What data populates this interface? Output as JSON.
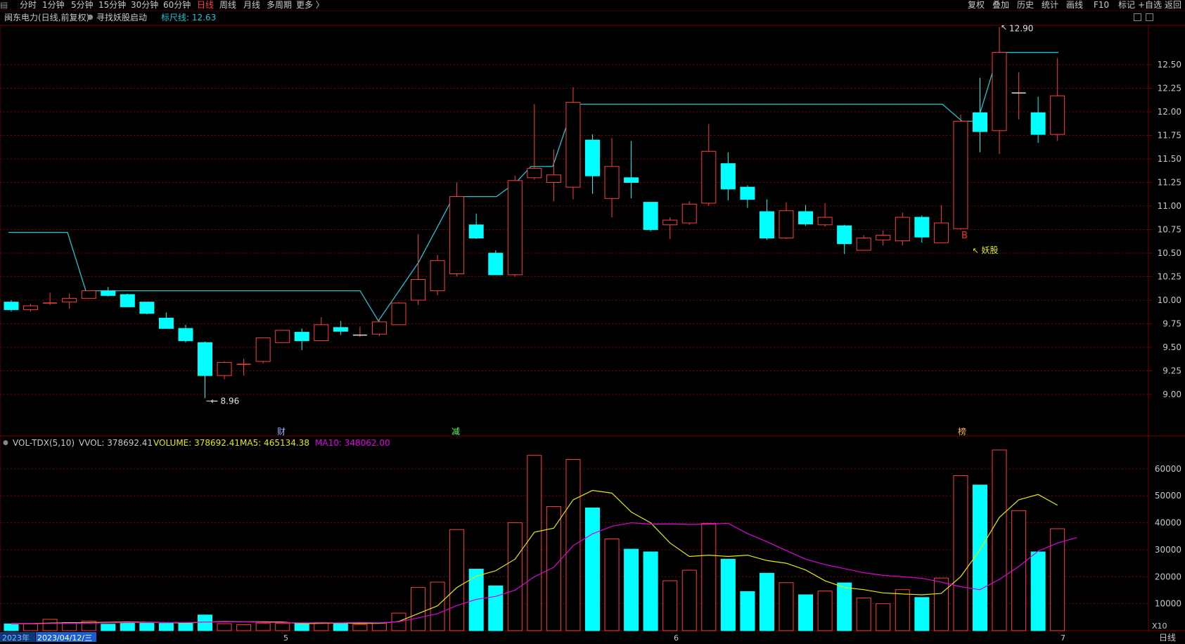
{
  "toolbar": {
    "left_items": [
      "分时",
      "1分钟",
      "5分钟",
      "15分钟",
      "30分钟",
      "60分钟",
      "日线",
      "周线",
      "月线",
      "多周期",
      "更多 〉"
    ],
    "active": "日线",
    "right_items": [
      "复权",
      "叠加",
      "历史",
      "统计",
      "画线",
      "F10",
      "标记",
      "+自选",
      "返回"
    ]
  },
  "info": {
    "stock": "闽东电力(日线,前复权)",
    "indicator": "寻找妖股启动",
    "ruler": "标尺线: 12.63"
  },
  "vol_info": {
    "name": "VOL-TDX(5,10)",
    "vvol": "VVOL: 378692.41",
    "volume": "VOLUME: 378692.41",
    "ma5": "MA5: 465134.38",
    "ma10": "MA10: 348062.00"
  },
  "colors": {
    "up": "#ff3d3d",
    "down": "#00ffff",
    "grid": "#7a0000",
    "guide": "#19c7d4",
    "ma5": "#e8e800",
    "ma10": "#e000e0",
    "axis_text": "#c8c8c8",
    "label": "#ff8c00"
  },
  "chart_data": {
    "type": "candlestick",
    "price_axis": {
      "ylim": [
        8.8,
        13.0
      ],
      "ticks": [
        "9.00",
        "9.25",
        "9.50",
        "9.75",
        "10.00",
        "10.25",
        "10.50",
        "10.75",
        "11.00",
        "11.25",
        "11.50",
        "11.75",
        "12.00",
        "12.25",
        "12.50"
      ]
    },
    "volume_axis": {
      "ylim": [
        0,
        67000
      ],
      "ticks": [
        "10000",
        "20000",
        "30000",
        "40000",
        "50000",
        "60000"
      ],
      "unit_label": "X10"
    },
    "candles": [
      {
        "o": 9.98,
        "h": 10.0,
        "l": 9.88,
        "c": 9.9
      },
      {
        "o": 9.9,
        "h": 9.96,
        "l": 9.88,
        "c": 9.94
      },
      {
        "o": 9.97,
        "h": 10.08,
        "l": 9.95,
        "c": 9.97
      },
      {
        "o": 9.98,
        "h": 10.07,
        "l": 9.91,
        "c": 10.02
      },
      {
        "o": 10.02,
        "h": 10.1,
        "l": 10.02,
        "c": 10.1
      },
      {
        "o": 10.1,
        "h": 10.14,
        "l": 10.04,
        "c": 10.05
      },
      {
        "o": 10.06,
        "h": 10.07,
        "l": 9.93,
        "c": 9.93
      },
      {
        "o": 9.98,
        "h": 9.98,
        "l": 9.85,
        "c": 9.86
      },
      {
        "o": 9.81,
        "h": 9.87,
        "l": 9.7,
        "c": 9.7
      },
      {
        "o": 9.7,
        "h": 9.74,
        "l": 9.55,
        "c": 9.57
      },
      {
        "o": 9.55,
        "h": 9.56,
        "l": 8.96,
        "c": 9.2
      },
      {
        "o": 9.2,
        "h": 9.35,
        "l": 9.16,
        "c": 9.34
      },
      {
        "o": 9.32,
        "h": 9.38,
        "l": 9.2,
        "c": 9.32
      },
      {
        "o": 9.35,
        "h": 9.6,
        "l": 9.33,
        "c": 9.6
      },
      {
        "o": 9.55,
        "h": 9.68,
        "l": 9.55,
        "c": 9.68
      },
      {
        "o": 9.66,
        "h": 9.7,
        "l": 9.47,
        "c": 9.57
      },
      {
        "o": 9.57,
        "h": 9.82,
        "l": 9.57,
        "c": 9.74
      },
      {
        "o": 9.71,
        "h": 9.78,
        "l": 9.63,
        "c": 9.67
      },
      {
        "o": 9.63,
        "h": 9.72,
        "l": 9.61,
        "c": 9.63
      },
      {
        "o": 9.64,
        "h": 9.79,
        "l": 9.62,
        "c": 9.77
      },
      {
        "o": 9.74,
        "h": 9.98,
        "l": 9.74,
        "c": 9.97
      },
      {
        "o": 10.0,
        "h": 10.7,
        "l": 9.95,
        "c": 10.22
      },
      {
        "o": 10.1,
        "h": 10.48,
        "l": 10.05,
        "c": 10.42
      },
      {
        "o": 10.28,
        "h": 11.25,
        "l": 10.25,
        "c": 11.1
      },
      {
        "o": 10.8,
        "h": 10.92,
        "l": 10.65,
        "c": 10.66
      },
      {
        "o": 10.5,
        "h": 10.53,
        "l": 10.27,
        "c": 10.27
      },
      {
        "o": 10.27,
        "h": 11.32,
        "l": 10.25,
        "c": 11.27
      },
      {
        "o": 11.3,
        "h": 12.08,
        "l": 11.28,
        "c": 11.4
      },
      {
        "o": 11.25,
        "h": 11.6,
        "l": 11.05,
        "c": 11.33
      },
      {
        "o": 11.2,
        "h": 12.26,
        "l": 11.07,
        "c": 12.1
      },
      {
        "o": 11.7,
        "h": 11.76,
        "l": 11.13,
        "c": 11.32
      },
      {
        "o": 11.08,
        "h": 11.72,
        "l": 10.88,
        "c": 11.42
      },
      {
        "o": 11.3,
        "h": 11.69,
        "l": 11.08,
        "c": 11.25
      },
      {
        "o": 11.04,
        "h": 11.04,
        "l": 10.73,
        "c": 10.75
      },
      {
        "o": 10.8,
        "h": 10.88,
        "l": 10.65,
        "c": 10.85
      },
      {
        "o": 10.82,
        "h": 11.05,
        "l": 10.8,
        "c": 11.02
      },
      {
        "o": 11.03,
        "h": 11.87,
        "l": 11.0,
        "c": 11.58
      },
      {
        "o": 11.45,
        "h": 11.57,
        "l": 11.06,
        "c": 11.18
      },
      {
        "o": 11.2,
        "h": 11.22,
        "l": 10.98,
        "c": 11.07
      },
      {
        "o": 10.94,
        "h": 11.07,
        "l": 10.64,
        "c": 10.66
      },
      {
        "o": 10.66,
        "h": 11.04,
        "l": 10.65,
        "c": 10.95
      },
      {
        "o": 10.94,
        "h": 11.01,
        "l": 10.79,
        "c": 10.81
      },
      {
        "o": 10.8,
        "h": 11.03,
        "l": 10.78,
        "c": 10.88
      },
      {
        "o": 10.79,
        "h": 10.8,
        "l": 10.49,
        "c": 10.6
      },
      {
        "o": 10.53,
        "h": 10.69,
        "l": 10.53,
        "c": 10.66
      },
      {
        "o": 10.64,
        "h": 10.74,
        "l": 10.58,
        "c": 10.69
      },
      {
        "o": 10.63,
        "h": 10.93,
        "l": 10.58,
        "c": 10.88
      },
      {
        "o": 10.88,
        "h": 10.9,
        "l": 10.61,
        "c": 10.67
      },
      {
        "o": 10.61,
        "h": 11.01,
        "l": 10.61,
        "c": 10.82
      },
      {
        "o": 10.76,
        "h": 11.97,
        "l": 10.75,
        "c": 11.9
      },
      {
        "o": 11.99,
        "h": 12.36,
        "l": 11.57,
        "c": 11.79
      },
      {
        "o": 11.8,
        "h": 12.9,
        "l": 11.55,
        "c": 12.63
      },
      {
        "o": 12.2,
        "h": 12.42,
        "l": 11.92,
        "c": 12.2
      },
      {
        "o": 11.99,
        "h": 12.16,
        "l": 11.67,
        "c": 11.76
      },
      {
        "o": 11.76,
        "h": 12.57,
        "l": 11.69,
        "c": 12.17
      }
    ],
    "volume": [
      2500,
      2500,
      4200,
      3000,
      3500,
      2400,
      2800,
      2800,
      2700,
      2600,
      5800,
      2600,
      2200,
      2800,
      2700,
      2700,
      3000,
      2600,
      2300,
      2800,
      6500,
      16000,
      18000,
      37500,
      22800,
      16600,
      40000,
      65000,
      46000,
      63500,
      45500,
      34000,
      30200,
      29200,
      18500,
      22400,
      39800,
      26500,
      14500,
      21300,
      17800,
      13300,
      14700,
      17700,
      12100,
      10000,
      15200,
      12300,
      19500,
      57500,
      54000,
      67000,
      44500,
      29200,
      37800
    ],
    "ma5": [
      2600,
      2600,
      2800,
      2900,
      3000,
      3100,
      3200,
      3100,
      3000,
      2800,
      3200,
      3400,
      3300,
      3300,
      3200,
      2600,
      2700,
      2800,
      2700,
      2700,
      3400,
      6300,
      9200,
      16000,
      20200,
      22200,
      26500,
      36500,
      38000,
      48500,
      52000,
      51000,
      44000,
      40000,
      32500,
      27500,
      28000,
      27500,
      28000,
      26000,
      25000,
      22500,
      18500,
      16000,
      15200,
      14000,
      13600,
      13300,
      13800,
      20000,
      30000,
      42000,
      48500,
      50500,
      46500
    ],
    "ma10": [
      2500,
      2550,
      2650,
      2700,
      2800,
      2900,
      3000,
      3000,
      3000,
      3000,
      3200,
      3300,
      3300,
      3100,
      3000,
      2900,
      2900,
      2900,
      3000,
      2900,
      3300,
      4700,
      6300,
      9300,
      11600,
      12700,
      15000,
      20000,
      23500,
      31500,
      35900,
      38700,
      40000,
      39500,
      39600,
      39400,
      39500,
      39800,
      36000,
      33000,
      29700,
      26500,
      24500,
      23000,
      21500,
      20500,
      20000,
      19400,
      18000,
      16300,
      15200,
      19000,
      23800,
      29500,
      32500,
      34500
    ]
  },
  "markers": {
    "low_label": "8.96",
    "high_label": "12.90",
    "buy_signal": "B",
    "signal_text": "妖股",
    "event_labels": [
      "财",
      "减",
      "榜"
    ],
    "date_left": "2023年",
    "date_cursor": "2023/04/12/三",
    "months": [
      "5",
      "6",
      "7"
    ],
    "period_label": "日线"
  }
}
